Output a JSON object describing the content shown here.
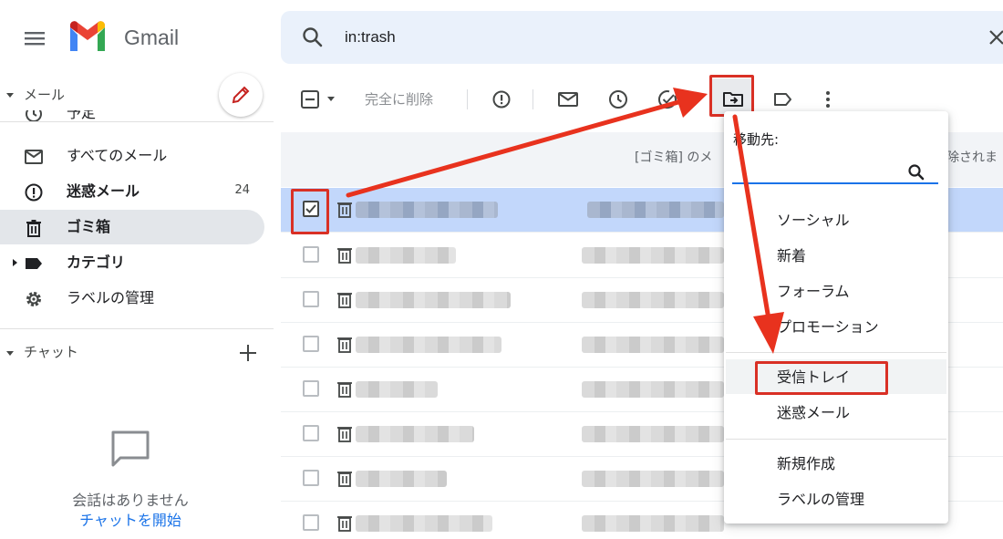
{
  "app": {
    "name": "Gmail"
  },
  "search": {
    "query": "in:trash"
  },
  "sidebar": {
    "mail_section": "メール",
    "items": [
      {
        "label": "予定",
        "icon": "scheduled-icon"
      },
      {
        "label": "すべてのメール",
        "icon": "mail-icon"
      },
      {
        "label": "迷惑メール",
        "icon": "spam-icon",
        "count": "24"
      },
      {
        "label": "ゴミ箱",
        "icon": "trash-icon"
      },
      {
        "label": "カテゴリ",
        "icon": "label-icon"
      },
      {
        "label": "ラベルの管理",
        "icon": "gear-icon"
      }
    ],
    "chat_section": "チャット",
    "chat_empty": "会話はありません",
    "chat_start": "チャットを開始"
  },
  "toolbar": {
    "delete_forever": "完全に削除",
    "icons": [
      "select-icon",
      "spam-report-icon",
      "mark-unread-icon",
      "snooze-icon",
      "add-task-icon",
      "move-to-icon",
      "label-icon",
      "more-icon"
    ]
  },
  "list": {
    "info_text": "[ゴミ箱] のメ",
    "info_text_right": "除されま"
  },
  "move_menu": {
    "title": "移動先:",
    "items": [
      "ソーシャル",
      "新着",
      "フォーラム",
      "プロモーション"
    ],
    "highlighted": "受信トレイ",
    "items2": [
      "迷惑メール"
    ],
    "actions": [
      "新規作成",
      "ラベルの管理"
    ]
  },
  "colors": {
    "annotation": "#d93025",
    "selected_row": "#c2d7fb",
    "search_bg": "#eaf1fb"
  }
}
